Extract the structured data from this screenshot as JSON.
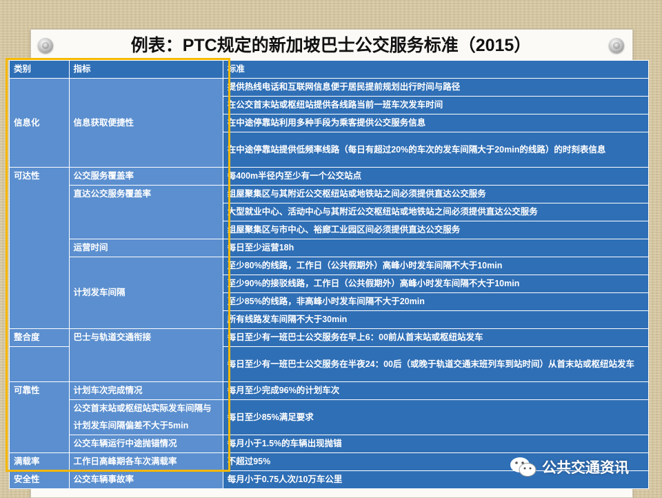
{
  "title": "例表：PTC规定的新加坡巴士公交服务标准（2015）",
  "table": {
    "headers": [
      "类别",
      "指标",
      "标准"
    ],
    "groups": {
      "g1": {
        "category": "信息化",
        "indicator": "信息获取便捷性",
        "standards": [
          "提供热线电话和互联网信息便于居民提前规划出行时间与路径",
          "在公交首末站或枢纽站提供各线路当前一班车次发车时间",
          "在中途停靠站利用多种手段为乘客提供公交服务信息",
          "在中途停靠站提供低频率线路（每日有超过20%的车次的发车间隔大于20min的线路）的时刻表信息"
        ]
      },
      "g2": {
        "category": "可达性",
        "indicators": [
          "公交服务覆盖率",
          "直达公交服务覆盖率",
          "运营时间",
          "计划发车间隔"
        ],
        "standards": [
          "每400m半径内至少有一个公交站点",
          "组屋聚集区与其附近公交枢纽站或地铁站之间必须提供直达公交服务",
          "大型就业中心、活动中心与其附近公交枢纽站或地铁站之间必须提供直达公交服务",
          "组屋聚集区与市中心、裕廊工业园区间必须提供直达公交服务",
          "每日至少运营18h",
          "至少80%的线路，工作日（公共假期外）高峰小时发车间隔不大于10min",
          "至少90%的接驳线路，工作日（公共假期外）高峰小时发车间隔不大于10min",
          "至少85%的线路，非高峰小时发车间隔不大于20min",
          "所有线路发车间隔不大于30min"
        ]
      },
      "g3": {
        "category": "整合度",
        "indicator": "巴士与轨道交通衔接",
        "standards": [
          "每日至少有一班巴士公交服务在早上6：00前从首末站或枢纽站发车",
          "每日至少有一班巴士公交服务在半夜24：00后（或晚于轨道交通末班列车到站时间）从首末站或枢纽站发车"
        ]
      },
      "g4": {
        "category": "可靠性",
        "indicators": [
          "计划车次完成情况",
          "公交首末站或枢纽站实际发车间隔与计划发车间隔偏差不大于5min",
          "公交车辆运行中途抛锚情况"
        ],
        "standards": [
          "每月至少完成96%的计划车次",
          "每日至少85%满足要求",
          "每月小于1.5%的车辆出现抛锚"
        ]
      },
      "g5": {
        "category": "满载率",
        "indicator": "工作日高峰期各车次满载率",
        "standard": "不超过95%"
      },
      "g6": {
        "category": "安全性",
        "indicator": "公交车辆事故率",
        "standard": "每月小于0.75人次/10万车公里"
      }
    }
  },
  "watermark": {
    "text": "公共交通资讯",
    "icon": "wechat-icon"
  },
  "colors": {
    "header_bg": "#2f6fb6",
    "cell_bg": "#5b8fcf",
    "standard_bg": "#2f6fb6",
    "highlight": "#f5b800"
  }
}
